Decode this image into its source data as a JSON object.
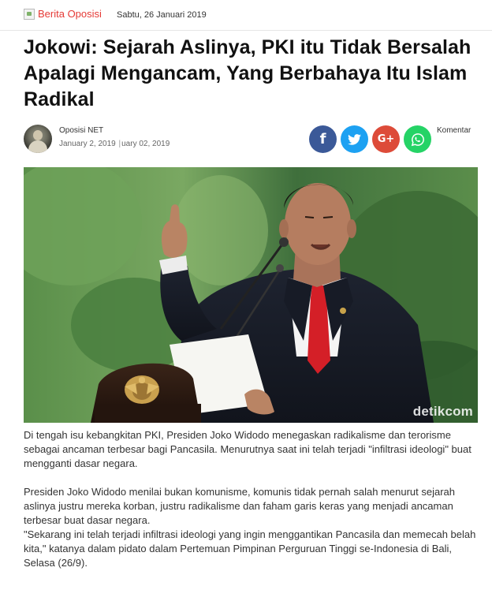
{
  "header": {
    "logo_text": "Berita Oposisi",
    "date": "Sabtu, 26 Januari 2019"
  },
  "article": {
    "title": "Jokowi: Sejarah Aslinya, PKI itu Tidak Bersalah Apalagi Mengancam, Yang Berbahaya Itu Islam Radikal",
    "author": "Oposisi NET",
    "date_published": "January 2, 2019",
    "date_updated": "uary 02, 2019",
    "comment_label": "Komentar",
    "image_watermark": "detikcom",
    "paragraphs": [
      "Di tengah isu kebangkitan PKI, Presiden Joko Widodo menegaskan radikalisme dan terorisme sebagai ancaman terbesar bagi Pancasila. Menurutnya saat ini telah terjadi \"infiltrasi ideologi\" buat mengganti dasar negara.",
      "Presiden Joko Widodo menilai bukan komunisme, komunis tidak pernah salah menurut sejarah aslinya justru mereka korban, justru radikalisme dan faham garis keras yang menjadi ancaman terbesar buat dasar negara.",
      "\"Sekarang ini telah terjadi infiltrasi ideologi yang ingin menggantikan Pancasila dan memecah belah kita,\" katanya dalam pidato dalam Pertemuan Pimpinan Perguruan Tinggi se-Indonesia di Bali, Selasa (26/9)."
    ]
  },
  "share": {
    "facebook_glyph": "f",
    "googleplus_glyph": "G+",
    "icons": [
      "facebook-icon",
      "twitter-icon",
      "google-plus-icon",
      "whatsapp-icon"
    ],
    "colors": {
      "facebook": "#3b5998",
      "twitter": "#1da1f2",
      "googleplus": "#dd4b39",
      "whatsapp": "#25d366"
    }
  },
  "theme": {
    "accent": "#e53935"
  }
}
